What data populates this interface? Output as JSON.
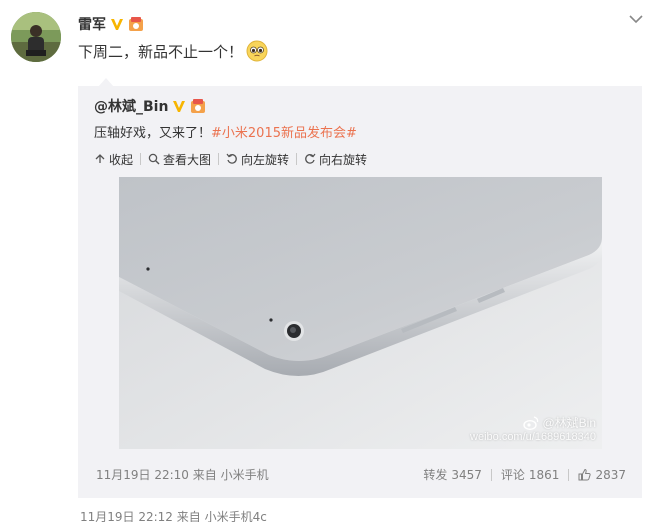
{
  "post": {
    "author": "雷军",
    "text": "下周二，新品不止一个！",
    "time": "11月19日 22:12",
    "from_label": "来自",
    "source": "小米手机4c"
  },
  "repost": {
    "author": "@林斌_Bin",
    "text_prefix": "压轴好戏，又来了！",
    "hashtag": "#小米2015新品发布会#",
    "toolbar": {
      "collapse": "收起",
      "view_large": "查看大图",
      "rotate_left": "向左旋转",
      "rotate_right": "向右旋转"
    },
    "image_watermark": {
      "name": "@林斌Bin",
      "url": "weibo.com/u/1689618340"
    },
    "time": "11月19日 22:10",
    "from_label": "来自",
    "source": "小米手机",
    "stats": {
      "forward_label": "转发",
      "forward_count": "3457",
      "comment_label": "评论",
      "comment_count": "1861",
      "like_count": "2837"
    }
  },
  "colors": {
    "accent": "#eb7350",
    "vip_badge": "#f7b500",
    "repost_bg": "#f2f2f5",
    "muted_text": "#808080"
  },
  "icons": [
    "verified-v-icon",
    "vip-badge-icon",
    "chevron-down-icon",
    "pleading-face-emoji",
    "collapse-arrow-icon",
    "magnifier-icon",
    "rotate-left-icon",
    "rotate-right-icon",
    "weibo-logo-icon",
    "comment-icon",
    "like-icon"
  ]
}
